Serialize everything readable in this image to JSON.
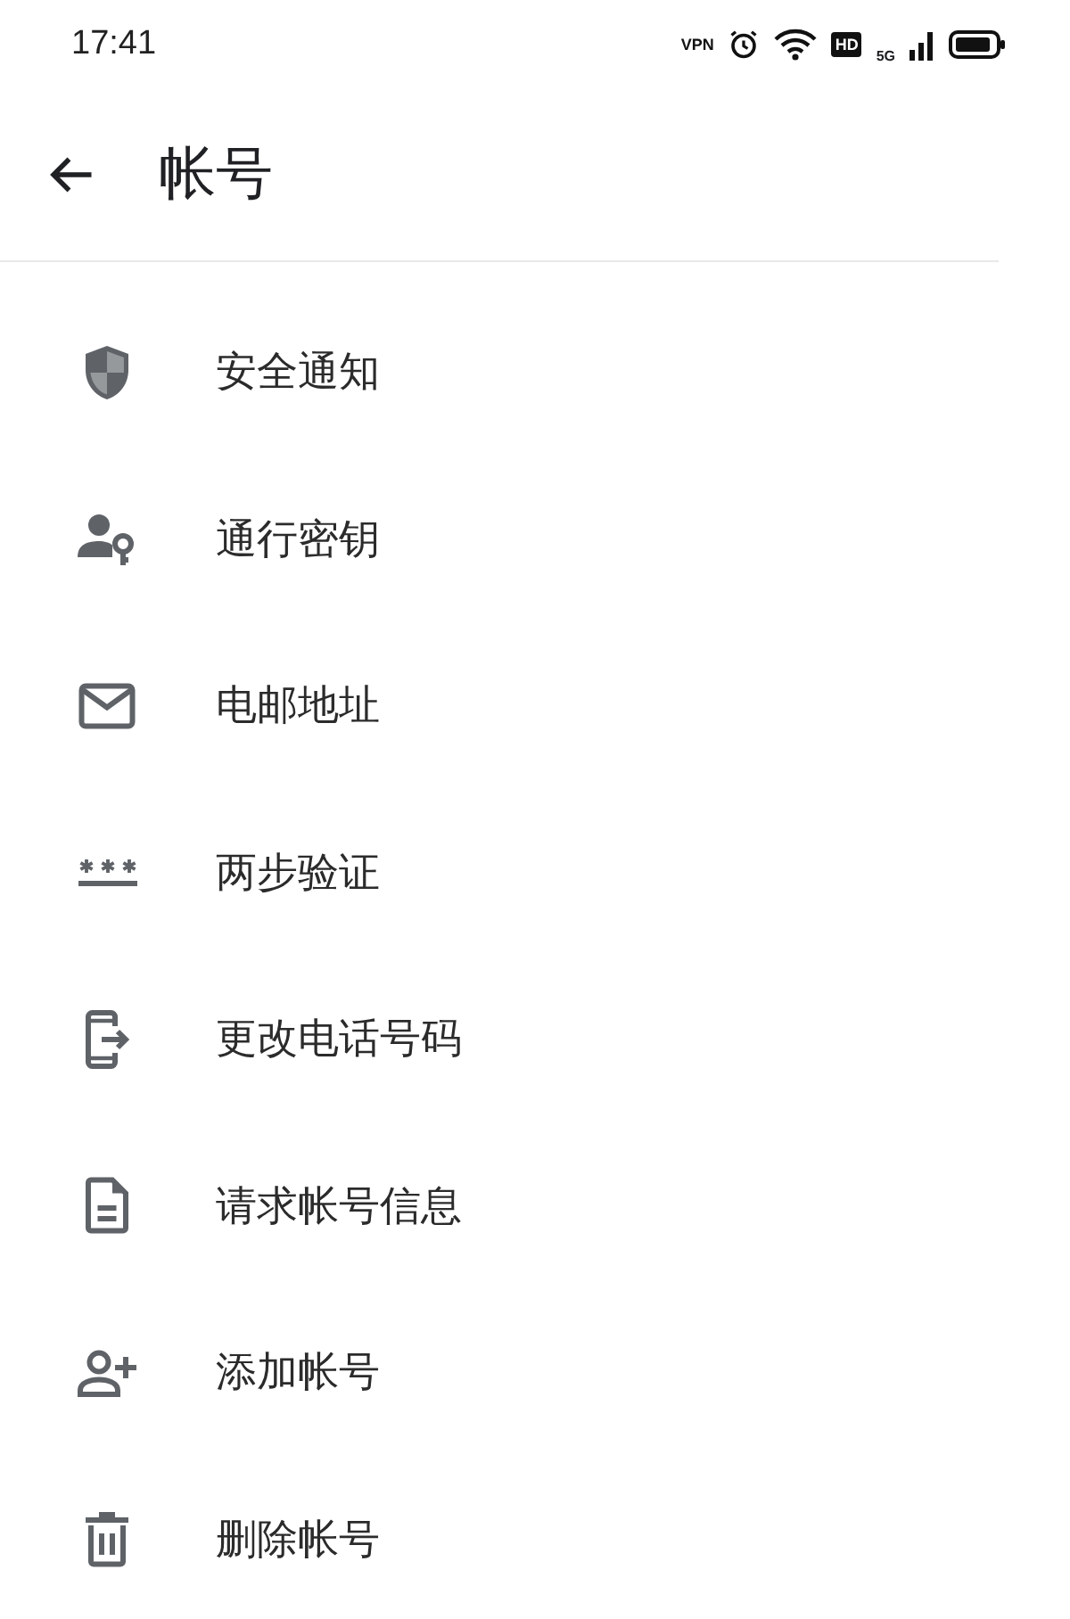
{
  "status_bar": {
    "time": "17:41",
    "vpn": "VPN",
    "hd": "HD",
    "network": "5G"
  },
  "header": {
    "title": "帐号"
  },
  "items": [
    {
      "kind": "shield",
      "label": "安全通知"
    },
    {
      "kind": "passkey",
      "label": "通行密钥"
    },
    {
      "kind": "mail",
      "label": "电邮地址"
    },
    {
      "kind": "password",
      "label": "两步验证"
    },
    {
      "kind": "phone",
      "label": "更改电话号码"
    },
    {
      "kind": "document",
      "label": "请求帐号信息"
    },
    {
      "kind": "add-person",
      "label": "添加帐号"
    },
    {
      "kind": "trash",
      "label": "删除帐号"
    }
  ]
}
